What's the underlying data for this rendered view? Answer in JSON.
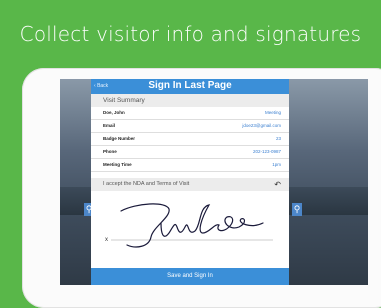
{
  "headline": "Collect visitor info and signatures",
  "nav": {
    "back_label": "Back",
    "title": "Sign In Last Page"
  },
  "summary": {
    "header": "Visit Summary",
    "rows": [
      {
        "label": "Doe, John",
        "value": "Meeting"
      },
      {
        "label": "Email",
        "value": "jdoe23@gmail.com"
      },
      {
        "label": "Badge Number",
        "value": "23"
      },
      {
        "label": "Phone",
        "value": "202-123-0987"
      },
      {
        "label": "Meeting Time",
        "value": "1pm"
      }
    ]
  },
  "signature": {
    "header": "I accept the NDA and Terms of Visit",
    "x_mark": "x"
  },
  "footer": {
    "button_label": "Save and Sign In"
  },
  "colors": {
    "background": "#59b749",
    "accent": "#3b8fd8"
  },
  "icons": {
    "undo": "undo-icon",
    "back": "chevron-left-icon"
  }
}
